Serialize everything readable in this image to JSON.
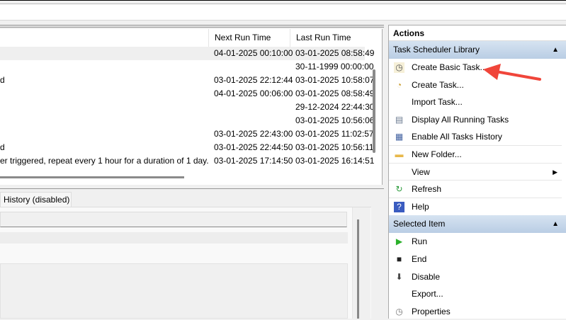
{
  "table": {
    "columns": [
      "Next Run Time",
      "Last Run Time"
    ],
    "rows": [
      {
        "trigger": "",
        "next": "04-01-2025 00:10:00",
        "last": "03-01-2025 08:58:49"
      },
      {
        "trigger": "",
        "next": "",
        "last": "30-11-1999 00:00:00"
      },
      {
        "trigger": "d",
        "next": "03-01-2025 22:12:44",
        "last": "03-01-2025 10:58:07"
      },
      {
        "trigger": "",
        "next": "04-01-2025 00:06:00",
        "last": "03-01-2025 08:58:49"
      },
      {
        "trigger": "",
        "next": "",
        "last": "29-12-2024 22:44:30"
      },
      {
        "trigger": "",
        "next": "",
        "last": "03-01-2025 10:56:06"
      },
      {
        "trigger": "",
        "next": "03-01-2025 22:43:00",
        "last": "03-01-2025 11:02:57"
      },
      {
        "trigger": "d",
        "next": "03-01-2025 22:44:50",
        "last": "03-01-2025 10:56:11"
      },
      {
        "trigger": "er triggered, repeat every 1 hour for a duration of 1 day.",
        "next": "03-01-2025 17:14:50",
        "last": "03-01-2025 16:14:51"
      }
    ]
  },
  "lower": {
    "tab_label": "History (disabled)"
  },
  "actions": {
    "title": "Actions",
    "sections": [
      {
        "title": "Task Scheduler Library",
        "items": [
          {
            "label": "Create Basic Task...",
            "icon": "create-basic-task-icon"
          },
          {
            "label": "Create Task...",
            "icon": "create-task-icon"
          },
          {
            "label": "Import Task...",
            "icon": ""
          },
          {
            "label": "Display All Running Tasks",
            "icon": "running-tasks-icon"
          },
          {
            "label": "Enable All Tasks History",
            "icon": "history-icon"
          },
          {
            "label": "New Folder...",
            "icon": "folder-icon"
          },
          {
            "label": "View",
            "icon": ""
          },
          {
            "label": "Refresh",
            "icon": "refresh-icon"
          },
          {
            "label": "Help",
            "icon": "help-icon"
          }
        ]
      },
      {
        "title": "Selected Item",
        "items": [
          {
            "label": "Run",
            "icon": "run-icon"
          },
          {
            "label": "End",
            "icon": "end-icon"
          },
          {
            "label": "Disable",
            "icon": "disable-icon"
          },
          {
            "label": "Export...",
            "icon": ""
          },
          {
            "label": "Properties",
            "icon": "properties-icon"
          }
        ]
      }
    ]
  },
  "colors": {
    "annotation_arrow": "#f0453a",
    "section_header": "#c6d7ea"
  }
}
